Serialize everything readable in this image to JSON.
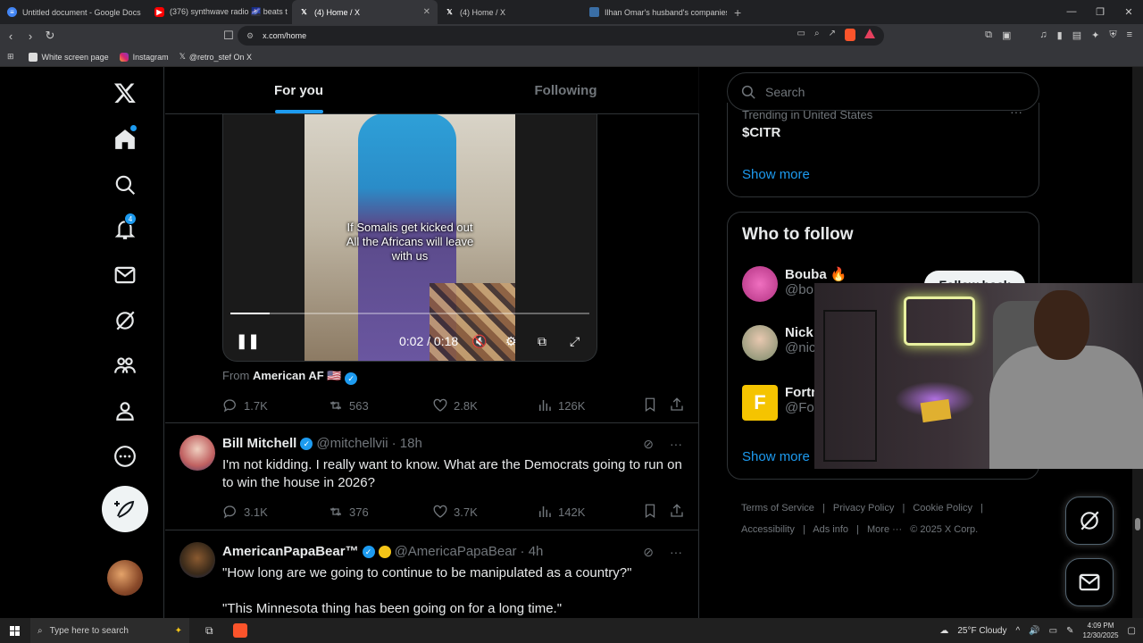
{
  "browser": {
    "tabs": [
      {
        "title": "Untitled document - Google Docs",
        "active": false
      },
      {
        "title": "(376) synthwave radio 🌌 beats t",
        "active": false
      },
      {
        "title": "(4) Home / X",
        "active": true
      },
      {
        "title": "(4) Home / X",
        "active": false
      },
      {
        "title": "Ilhan Omar's husband's companies s",
        "active": false
      }
    ],
    "url": "x.com/home",
    "bookmarks": [
      "White screen page",
      "Instagram",
      "@retro_stef On X"
    ]
  },
  "nav": {
    "notifications_badge": "4"
  },
  "feed": {
    "tabs": [
      "For you",
      "Following"
    ],
    "video": {
      "caption_lines": [
        "If Somalis get kicked out",
        "All the Africans will leave",
        "with us"
      ],
      "time": "0:02 / 0:18",
      "progress": 0.11
    },
    "from_label": "From",
    "from_account": "American AF 🇺🇸",
    "post1_stats": {
      "replies": "1.7K",
      "reposts": "563",
      "likes": "2.8K",
      "views": "126K"
    },
    "post2": {
      "name": "Bill Mitchell",
      "handle": "@mitchellvii",
      "time": "· 18h",
      "text": "I'm not kidding. I really want to know. What are the Democrats going to run on to win the house in 2026?",
      "stats": {
        "replies": "3.1K",
        "reposts": "376",
        "likes": "3.7K",
        "views": "142K"
      }
    },
    "post3": {
      "name": "AmericanPapaBear™",
      "handle": "@AmericaPapaBear",
      "time": "· 4h",
      "text_line1": "\"How long are we going to continue to be manipulated as a country?\"",
      "text_line2": "\"This Minnesota thing has been going on for a long time.\""
    }
  },
  "sidebar": {
    "search_placeholder": "Search",
    "trend_label": "Trending in United States",
    "trend_name": "$CITR",
    "show_more": "Show more",
    "who_to_follow": "Who to follow",
    "follow_label": "Follow back",
    "suggestions": [
      {
        "name": "Bouba 🔥",
        "handle": "@bo"
      },
      {
        "name": "Nick",
        "handle": "@nic"
      },
      {
        "name": "Fortn",
        "handle": "@For"
      }
    ],
    "footer_links": [
      "Terms of Service",
      "|",
      "Privacy Policy",
      "|",
      "Cookie Policy",
      "|",
      "Accessibility",
      "|",
      "Ads info",
      "|",
      "More ···",
      "© 2025 X Corp."
    ]
  },
  "taskbar": {
    "search_placeholder": "Type here to search",
    "weather": "25°F  Cloudy",
    "time": "4:09 PM",
    "date": "12/30/2025"
  },
  "colors": {
    "accent": "#1d9bf0",
    "background": "#000000",
    "border": "#2f3336"
  }
}
